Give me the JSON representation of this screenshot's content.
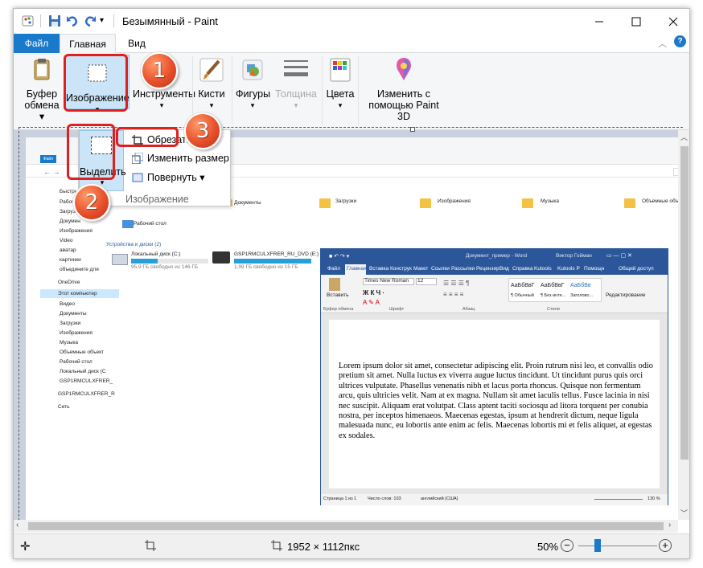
{
  "window": {
    "title": "Безымянный - Paint"
  },
  "tabs": {
    "file": "Файл",
    "home": "Главная",
    "view": "Вид"
  },
  "ribbon": {
    "clipboard": {
      "line1": "Буфер",
      "line2": "обмена"
    },
    "image": "Изображение",
    "tools": "Инструменты",
    "brushes": "Кисти",
    "shapes": "Фигуры",
    "size": "Толщина",
    "colors": "Цвета",
    "paint3d": {
      "line1": "Изменить с",
      "line2": "помощью Paint 3D"
    }
  },
  "image_menu": {
    "select": "Выделить",
    "crop": "Обрезать",
    "resize": "Изменить размер",
    "rotate": "Повернуть",
    "group_label": "Изображение"
  },
  "badges": {
    "one": "1",
    "two": "2",
    "three": "3"
  },
  "status": {
    "dimensions": "1952 × 1112пкс",
    "zoom": "50%"
  },
  "explorer": {
    "sidebar": [
      "Быстрый",
      "Рабочи",
      "Загрузк",
      "Докумен",
      "Изображения",
      "Video",
      "аватар",
      "картинки",
      "объедините для",
      "OneDrive",
      "Этот компьютер",
      "Видео",
      "Документы",
      "Загрузки",
      "Изображения",
      "Музыка",
      "Объемные объект",
      "Рабочий стол",
      "Локальный диск (С",
      "GSP1RMCULXFRER_",
      "GSP1RMCULXFRER_R",
      "Сеть"
    ],
    "folders": [
      "Документы",
      "Загрузки",
      "Изображения",
      "Музыка",
      "Объемные объекты"
    ],
    "desktop": "Рабочий стол",
    "devices_header": "Устройства и диски (2)",
    "drive1": {
      "name": "Локальный диск (C:)",
      "free": "95,9 ГБ свободно из 146 ГБ"
    },
    "drive2": {
      "name": "GSP1RMCULXFRER_RU_DVD (E:)",
      "free": "1,99 ГБ свободно из 15 ГБ"
    }
  },
  "word": {
    "title": "Документ_пример - Word",
    "user": "Виктор Гойман",
    "tabs": [
      "Файл",
      "Главная",
      "Вставка",
      "Конструк",
      "Макет",
      "Ссылки",
      "Рассылки",
      "Рецензир",
      "Вид",
      "Справка",
      "Kutools",
      "Kutools P",
      "Помощн",
      "Общий доступ"
    ],
    "font": "Times New Roman",
    "font_size": "12",
    "paste": "Вставить",
    "styles": [
      "АаБбВвГ",
      "АаБбВвГ",
      "АаБбВв"
    ],
    "style_names": [
      "¶ Обычный",
      "¶ Без инте...",
      "Заголово..."
    ],
    "editing": "Редактирование",
    "groups": [
      "Буфер обмена",
      "Шрифт",
      "Абзац",
      "Стили"
    ],
    "body": "Lorem ipsum dolor sit amet, consectetur adipiscing elit. Proin rutrum nisi leo, et convallis odio pretium sit amet. Nulla luctus ex viverra augue luctus tincidunt. Ut tincidunt purus quis orci ultrices vulputate. Phasellus venenatis nibh et lacus porta rhoncus. Quisque non fermentum arcu, quis ultricies velit. Nam at ex magna. Nullam sit amet iaculis tellus. Fusce lacinia in nisi nec suscipit. Aliquam erat volutpat. Class aptent taciti sociosqu ad litora torquent per conubia nostra, per inceptos himenaeos. Maecenas egestas, ipsum at hendrerit dictum, neque ligula malesuada nunc, eu lobortis ante enim ac felis. Maecenas lobortis mi et felis aliquet, at egestas ex sodales.",
    "status_page": "Страница 1 из 1",
    "status_words": "Число слов: 103",
    "status_lang": "английский (США)",
    "status_zoom": "130 %"
  },
  "colors": {
    "file_tab": "#1979ca",
    "accent_red": "#e0201e",
    "word_blue": "#2b579a"
  }
}
